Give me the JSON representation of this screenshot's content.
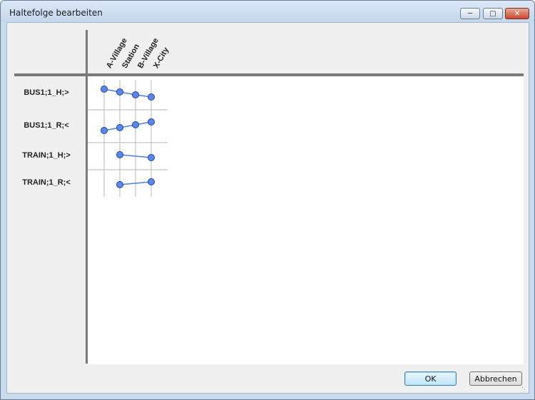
{
  "window": {
    "title": "Haltefolge bearbeiten",
    "minimize_icon": "minimize-icon",
    "maximize_icon": "maximize-icon",
    "close_icon": "close-icon"
  },
  "stations": [
    "A-Village",
    "Station",
    "B-Village",
    "X-City"
  ],
  "routes": [
    {
      "label": "BUS1;1_H;>",
      "stops": [
        0,
        1,
        2,
        3
      ]
    },
    {
      "label": "BUS1;1_R;<",
      "stops": [
        0,
        1,
        2,
        3
      ]
    },
    {
      "label": "TRAIN;1_H;>",
      "stops": [
        1,
        3
      ]
    },
    {
      "label": "TRAIN;1_R;<",
      "stops": [
        1,
        3
      ]
    }
  ],
  "buttons": {
    "ok": "OK",
    "cancel": "Abbrechen"
  },
  "colors": {
    "node_fill": "#5b88ee",
    "node_stroke": "#1f3f9a",
    "route_line": "#4d7fe0",
    "grid_line": "#b8b8b8"
  }
}
